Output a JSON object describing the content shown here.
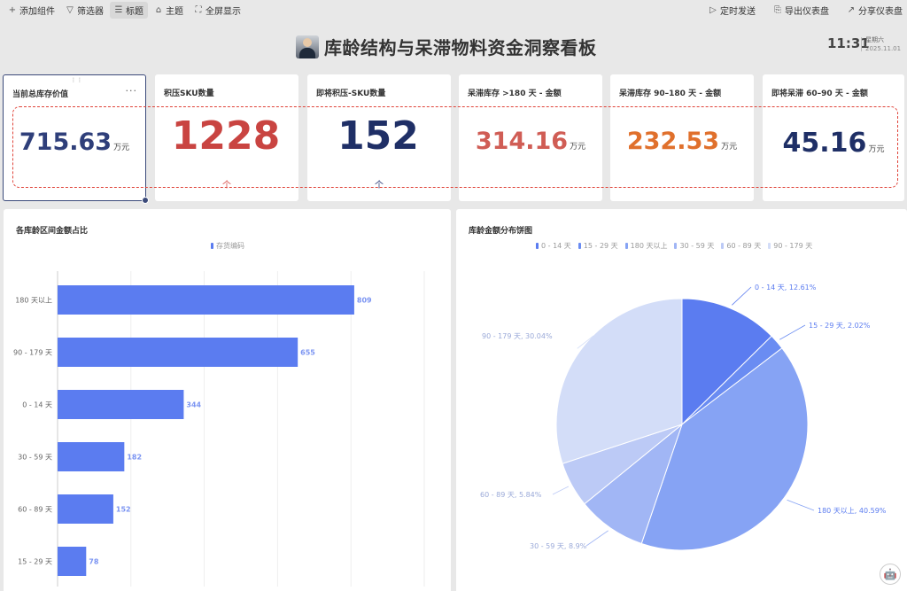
{
  "toolbar": {
    "left": [
      {
        "icon": "plus-icon",
        "label": "添加组件"
      },
      {
        "icon": "filter-icon",
        "label": "筛选器"
      },
      {
        "icon": "title-icon",
        "label": "标题"
      },
      {
        "icon": "theme-icon",
        "label": "主题"
      },
      {
        "icon": "fullscreen-icon",
        "label": "全屏显示"
      }
    ],
    "right": [
      {
        "icon": "play-icon",
        "label": "定时发送"
      },
      {
        "icon": "export-icon",
        "label": "导出仪表盘"
      },
      {
        "icon": "share-icon",
        "label": "分享仪表盘"
      }
    ]
  },
  "header": {
    "title": "库龄结构与呆滞物料资金洞察看板",
    "time": "11:31",
    "weekday": "星期六",
    "date": "2025.11.01"
  },
  "kpis": [
    {
      "title": "当前总库存价值",
      "value": "715.63",
      "unit": "万元",
      "color": "#2f3f7a",
      "sub": "",
      "selected": true
    },
    {
      "title": "积压SKU数量",
      "value": "1228",
      "unit": "",
      "color": "#c94441",
      "sub": "个",
      "sub_color": "#d9534f"
    },
    {
      "title": "即将积压-SKU数量",
      "value": "152",
      "unit": "",
      "color": "#1f2f66",
      "sub": "个",
      "sub_color": "#2f3f7a"
    },
    {
      "title": "呆滞库存 >180 天 - 金额",
      "value": "314.16",
      "unit": "万元",
      "color": "#d05d55",
      "sub": ""
    },
    {
      "title": "呆滞库存 90–180 天 - 金额",
      "value": "232.53",
      "unit": "万元",
      "color": "#e0702c",
      "sub": ""
    },
    {
      "title": "即将呆滞 60–90 天 - 金额",
      "value": "45.16",
      "unit": "万元",
      "color": "#1f2f66",
      "sub": ""
    }
  ],
  "bar_panel": {
    "title": "各库龄区间金额占比",
    "legend": "存货编码"
  },
  "pie_panel": {
    "title": "库龄金额分布饼图"
  },
  "chart_data": [
    {
      "type": "bar",
      "orientation": "horizontal",
      "title": "各库龄区间金额占比",
      "categories": [
        "180 天以上",
        "90 - 179 天",
        "0 - 14 天",
        "30 - 59 天",
        "60 - 89 天",
        "15 - 29 天"
      ],
      "series": [
        {
          "name": "存货编码",
          "values": [
            809,
            655,
            344,
            182,
            152,
            78
          ],
          "color": "#5b7cf0"
        }
      ],
      "xlim": [
        0,
        1000
      ],
      "grid": true,
      "legend": "top-center"
    },
    {
      "type": "pie",
      "title": "库龄金额分布饼图",
      "slices": [
        {
          "name": "0 - 14 天",
          "value": 12.61,
          "color": "#5b7cf0",
          "label": "0 - 14 天, 12.61%"
        },
        {
          "name": "15 - 29 天",
          "value": 2.02,
          "color": "#6a8cf2",
          "label": "15 - 29 天, 2.02%"
        },
        {
          "name": "180 天以上",
          "value": 40.59,
          "color": "#86a3f4",
          "label": "180 天以上, 40.59%"
        },
        {
          "name": "30 - 59 天",
          "value": 8.9,
          "color": "#a1b6f5",
          "label": "30 - 59 天, 8.9%"
        },
        {
          "name": "60 - 89 天",
          "value": 5.84,
          "color": "#bccaf6",
          "label": "60 - 89 天, 5.84%"
        },
        {
          "name": "90 - 179 天",
          "value": 30.04,
          "color": "#d3ddf8",
          "label": "90 - 179 天, 30.04%"
        }
      ],
      "legend": "top-center"
    }
  ]
}
